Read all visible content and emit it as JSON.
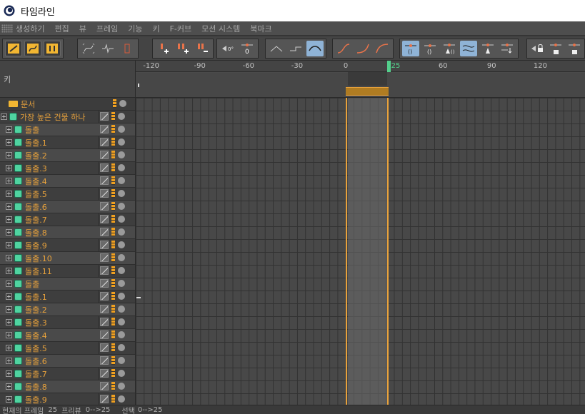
{
  "window": {
    "title": "타임라인"
  },
  "menu": [
    "생성하기",
    "편집",
    "뷰",
    "프레임",
    "기능",
    "키",
    "F-커브",
    "모션 시스템",
    "북마크"
  ],
  "toolbar": {
    "groups": [
      {
        "buttons": [
          "key-record-icon",
          "f-curve-mode-icon",
          "motion-mode-icon"
        ]
      },
      {
        "buttons": [
          "f-curve-view-icon",
          "wave-view-icon",
          "dope-sheet-icon"
        ]
      },
      {
        "buttons": [
          "add-key-icon",
          "add-multi-key-icon",
          "remove-key-icon"
        ]
      },
      {
        "buttons": [
          "zero-angle-icon",
          "zero-length-icon"
        ]
      },
      {
        "buttons": [
          "linear-interp-icon",
          "step-interp-icon",
          "spline-interp-icon"
        ]
      },
      {
        "buttons": [
          "ease-in-out-icon",
          "ease-in-icon",
          "ease-out-icon"
        ]
      },
      {
        "buttons": [
          "tangent-auto-icon",
          "tangent-break-icon",
          "tangent-lock-icon",
          "tangent-weight-icon",
          "tangent-zero-icon",
          "tangent-down-icon"
        ]
      },
      {
        "buttons": [
          "lock-time-icon",
          "lock-value-icon",
          "lock-all-icon"
        ]
      }
    ]
  },
  "left_panel": {
    "key_header": "키",
    "document_label": "문서",
    "root_label": "가장 높은 건물 하나",
    "items": [
      "돌출",
      "돌출.1",
      "돌출.2",
      "돌출.3",
      "돌출.4",
      "돌출.5",
      "돌출.6",
      "돌출.7",
      "돌출.8",
      "돌출.9",
      "돌출.10",
      "돌출.11",
      "돌출",
      "돌출.1",
      "돌출.2",
      "돌출.3",
      "돌출.4",
      "돌출.5",
      "돌출.6",
      "돌출.7",
      "돌출.8",
      "돌출.9"
    ]
  },
  "ruler": {
    "labels": [
      "-120",
      "-90",
      "-60",
      "-30",
      "0",
      "25",
      "60",
      "90",
      "120"
    ],
    "current_frame": "25"
  },
  "colors": {
    "accent": "#e8a23c",
    "playhead": "#53d08c",
    "object_icon": "#4fd3a0"
  },
  "status": {
    "current_frame_label": "현재의 프레임",
    "current_frame_value": "25",
    "preview_label": "프리뷰",
    "preview_value": "0-->25",
    "selection_label": "선택",
    "selection_value": "0-->25"
  }
}
